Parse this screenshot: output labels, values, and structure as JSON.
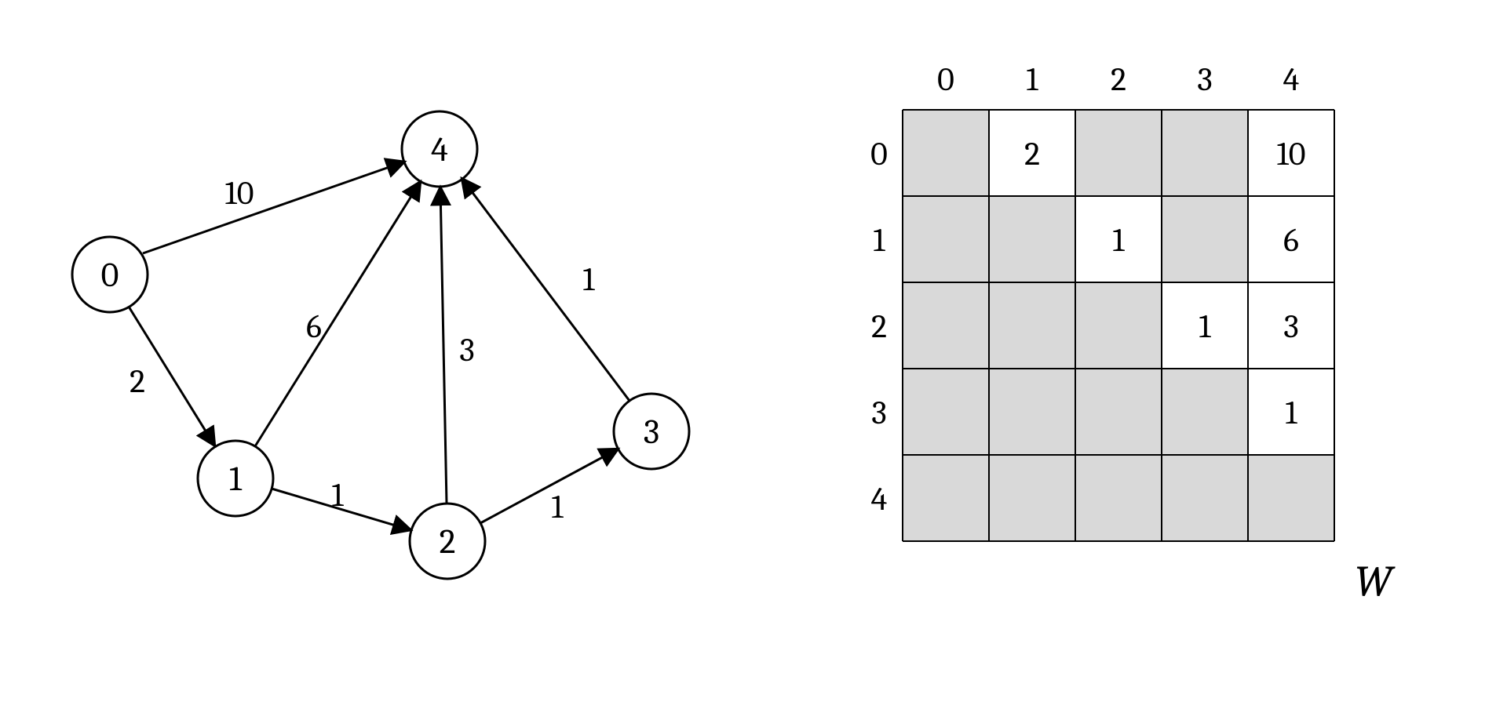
{
  "graph": {
    "nodes": [
      {
        "id": 0,
        "label": "0"
      },
      {
        "id": 1,
        "label": "1"
      },
      {
        "id": 2,
        "label": "2"
      },
      {
        "id": 3,
        "label": "3"
      },
      {
        "id": 4,
        "label": "4"
      }
    ],
    "edges": [
      {
        "from": 0,
        "to": 4,
        "weight": 10,
        "label": "10"
      },
      {
        "from": 0,
        "to": 1,
        "weight": 2,
        "label": "2"
      },
      {
        "from": 1,
        "to": 4,
        "weight": 6,
        "label": "6"
      },
      {
        "from": 1,
        "to": 2,
        "weight": 1,
        "label": "1"
      },
      {
        "from": 2,
        "to": 4,
        "weight": 3,
        "label": "3"
      },
      {
        "from": 2,
        "to": 3,
        "weight": 1,
        "label": "1"
      },
      {
        "from": 3,
        "to": 4,
        "weight": 1,
        "label": "1"
      }
    ]
  },
  "matrix": {
    "name": "W",
    "col_headers": [
      "0",
      "1",
      "2",
      "3",
      "4"
    ],
    "row_headers": [
      "0",
      "1",
      "2",
      "3",
      "4"
    ],
    "cells": [
      [
        null,
        "2",
        null,
        null,
        "10"
      ],
      [
        null,
        null,
        "1",
        null,
        "6"
      ],
      [
        null,
        null,
        null,
        "1",
        "3"
      ],
      [
        null,
        null,
        null,
        null,
        "1"
      ],
      [
        null,
        null,
        null,
        null,
        null
      ]
    ]
  }
}
